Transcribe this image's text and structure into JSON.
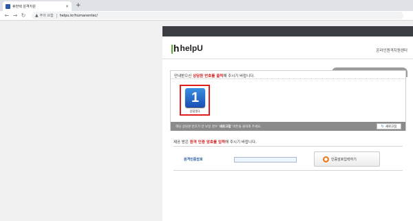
{
  "browser": {
    "tab_title": "휴먼텍 원격지원",
    "tab_close": "×",
    "new_tab": "+",
    "security_label": "주의 요함",
    "url": "helpu.kr/humanentec/"
  },
  "header": {
    "logo_mark": "h",
    "logo_text": "helpU",
    "center_name": "온라인원격지원센터"
  },
  "counselor_panel": {
    "instruction_prefix": "안내받으신 ",
    "instruction_highlight": "상담원 번호를 클릭",
    "instruction_suffix": "해 주시기 바랍니다.",
    "tel": "Tel : 053-767-1158",
    "counselors": [
      {
        "number": "1",
        "label": "상담원1"
      }
    ],
    "notice_prefix": "해당 상담원 번호가 안 보일 경우 ",
    "notice_highlight": "'새로고침'",
    "notice_suffix": " 버튼을 클릭해 주세요.",
    "refresh_label": "새로고침"
  },
  "code_form": {
    "instruction_prefix": "제공 받은 ",
    "instruction_highlight": "원격 인증 암호를 입력",
    "instruction_suffix": "해 주시기 바랍니다.",
    "label": "원격인증암호",
    "input_value": "",
    "submit_label": "인증암호입력하기"
  },
  "colors": {
    "accent_red": "#d62020",
    "badge_blue": "#1a4fb5",
    "logo_green": "#4aa31e",
    "submit_orange": "#ea7a1a"
  },
  "icons": [
    "favicon-icon",
    "back-arrow-icon",
    "forward-arrow-icon",
    "reload-icon",
    "warning-icon",
    "refresh-icon",
    "lock-key-icon"
  ]
}
